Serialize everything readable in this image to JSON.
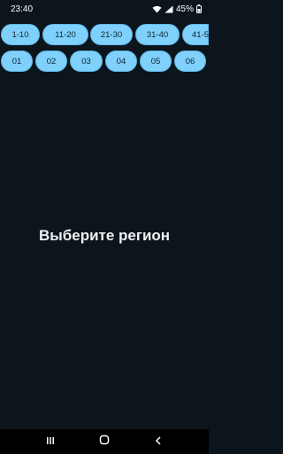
{
  "status_bar": {
    "time": "23:40",
    "battery": "45%",
    "icons": [
      "wifi-icon",
      "signal-icon",
      "battery-icon"
    ]
  },
  "range_tabs": [
    "1-10",
    "11-20",
    "21-30",
    "31-40",
    "41-5"
  ],
  "region_tabs": [
    "01",
    "02",
    "03",
    "04",
    "05",
    "06"
  ],
  "main": {
    "title": "Выберите регион"
  },
  "nav_bar": {
    "icons": [
      "recents-icon",
      "home-icon",
      "back-icon"
    ]
  },
  "colors": {
    "background": "#0d151c",
    "chip": "#7fd0fb",
    "chip_text": "#0f2533"
  }
}
